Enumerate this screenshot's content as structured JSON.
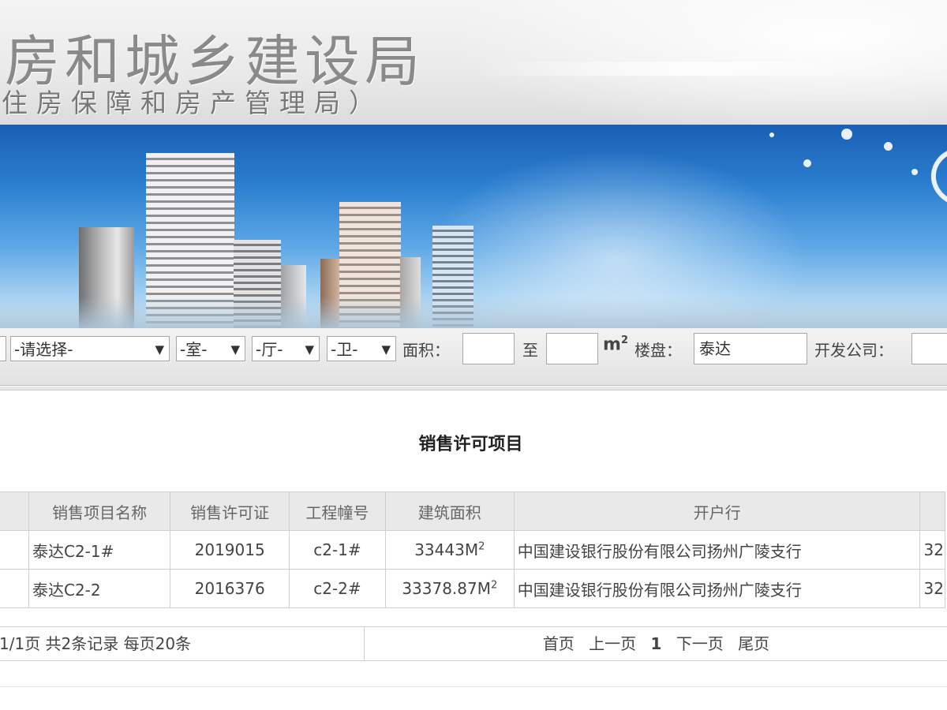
{
  "header": {
    "title": "房和城乡建设局",
    "subtitle": "住房保障和房产管理局）"
  },
  "search": {
    "region_select": "-请选择-",
    "room_select": "-室-",
    "hall_select": "-厅-",
    "bath_select": "-卫-",
    "area_label": "面积：",
    "area_from": "",
    "to_label": "至",
    "area_to": "",
    "unit_label": "m",
    "unit_sup": "2",
    "project_label": "楼盘：",
    "project_value": "泰达",
    "developer_label": "开发公司：",
    "developer_value": ""
  },
  "section": {
    "title": "销售许可项目"
  },
  "table": {
    "headers": [
      "销售项目名称",
      "销售许可证",
      "工程幢号",
      "建筑面积",
      "开户行"
    ],
    "rows": [
      {
        "name": "泰达C2-1#",
        "permit": "2019015",
        "building": "c2-1#",
        "area": "33443M",
        "area_sup": "2",
        "bank": "中国建设银行股份有限公司扬州广陵支行",
        "extra": "32"
      },
      {
        "name": "泰达C2-2",
        "permit": "2016376",
        "building": "c2-2#",
        "area": "33378.87M",
        "area_sup": "2",
        "bank": "中国建设银行股份有限公司扬州广陵支行",
        "extra": "32"
      }
    ]
  },
  "pager": {
    "summary": "1/1页 共2条记录 每页20条",
    "first": "首页",
    "prev": "上一页",
    "current": "1",
    "next": "下一页",
    "last": "尾页"
  },
  "colors": {
    "banner_sky": "#2b7fd0",
    "header_bg": "#e9e9e9",
    "table_header_bg": "#e9e9e9",
    "border": "#cfcfcf"
  }
}
